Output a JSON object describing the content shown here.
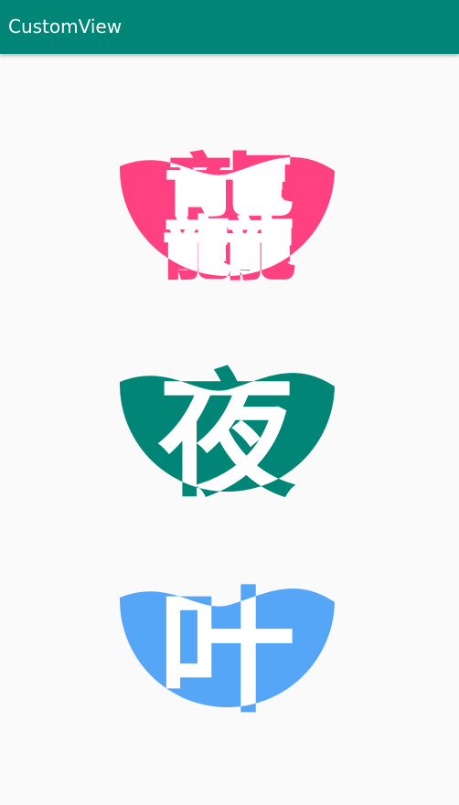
{
  "app_bar": {
    "title": "CustomView",
    "color": "#008577"
  },
  "wave_views": [
    {
      "character": "龘",
      "color": "#ff4081"
    },
    {
      "character": "夜",
      "color": "#008577"
    },
    {
      "character": "叶",
      "color": "#55a6f7"
    }
  ]
}
